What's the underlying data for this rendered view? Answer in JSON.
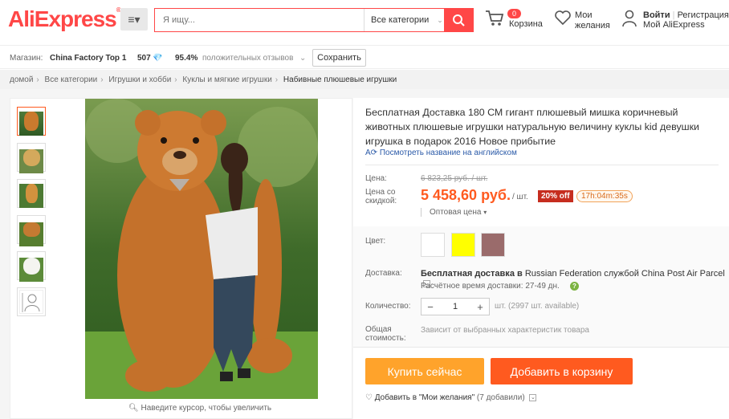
{
  "header": {
    "logo": "AliExpress",
    "search_placeholder": "Я ищу...",
    "category": "Все категории",
    "cart_count": "0",
    "cart_label": "Корзина",
    "wish_label_1": "Мои",
    "wish_label_2": "желания",
    "login": "Войти",
    "register": "Регистрация",
    "my_account": "Мой AliExpress"
  },
  "store": {
    "label": "Магазин:",
    "name": "China Factory Top 1",
    "score": "507",
    "feedback_pct": "95.4%",
    "feedback_label": "положительных отзывов",
    "save": "Сохранить"
  },
  "breadcrumbs": [
    "домой",
    "Все категории",
    "Игрушки и хобби",
    "Куклы и мягкие игрушки",
    "Набивные плюшевые игрушки"
  ],
  "product": {
    "title": "Бесплатная Доставка 180 СМ гигант плюшевый мишка коричневый животных плюшевые игрушки натуральную величину куклы kid девушки игрушка в подарок 2016 Новое прибытие",
    "translate_link": "Посмотреть название на английском",
    "price_label": "Цена:",
    "old_price": "6 823,25 руб. / шт.",
    "discount_label_1": "Цена со",
    "discount_label_2": "скидкой:",
    "price": "5 458,60 руб.",
    "unit": "/ шт.",
    "discount": "20% off",
    "timer": "17h:04m:35s",
    "wholesale": "Оптовая цена",
    "color_label": "Цвет:",
    "colors": [
      "#ffffff",
      "#ffff00",
      "#9a6b6b"
    ],
    "shipping_label": "Доставка:",
    "shipping_bold": "Бесплатная доставка в",
    "shipping_rest": " Russian Federation службой China Post Air Parcel",
    "shipping_est": "Расчётное время доставки: 27-49 дн.",
    "qty_label": "Количество:",
    "qty": "1",
    "qty_avail": "шт. (2997 шт. available)",
    "total_label_1": "Общая",
    "total_label_2": "стоимость:",
    "total_note": "Зависит от выбранных характеристик товара",
    "buy_now": "Купить сейчас",
    "add_to_cart": "Добавить в корзину",
    "wish_add": "Добавить в \"Мои желания\"",
    "wish_count": "(7 добавили)",
    "zoom_hint": "Наведите курсор, чтобы увеличить"
  }
}
